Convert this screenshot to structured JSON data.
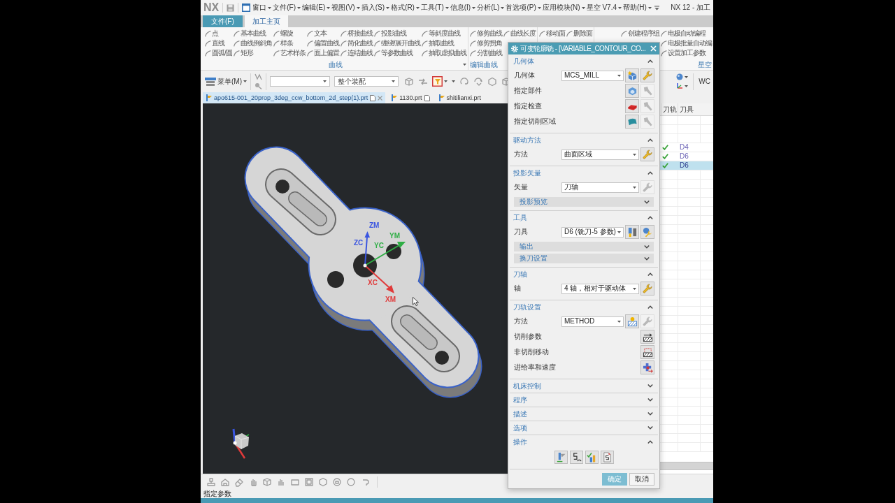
{
  "menu_bar": {
    "logo": "NX",
    "menus": [
      "窗口",
      "文件(F)",
      "编辑(E)",
      "视图(V)",
      "插入(S)",
      "格式(R)",
      "工具(T)",
      "信息(I)",
      "分析(L)",
      "首选项(P)",
      "应用模块(N)",
      "星空 V7.4",
      "帮助(H)"
    ],
    "window_title": "NX 12 - 加工"
  },
  "ribbon": {
    "tabs": [
      {
        "label": "文件(F)",
        "kind": "file",
        "selected": false
      },
      {
        "label": "加工主页",
        "kind": "tab",
        "selected": true
      }
    ],
    "groups": [
      {
        "label": "曲线",
        "more_menu": true,
        "columns": [
          [
            "点",
            "直线",
            "圆弧/圆"
          ],
          [
            "基本曲线",
            "曲线倒斜角",
            "矩形"
          ],
          [
            "螺旋",
            "样条",
            "艺术样条"
          ],
          [
            "文本",
            "偏置曲线",
            "面上偏置"
          ],
          [
            "桥接曲线",
            "简化曲线",
            "连结曲线"
          ],
          [
            "投影曲线",
            "缠绕/展开曲线",
            "等参数曲线"
          ],
          [
            "等斜度曲线",
            "抽取曲线",
            "抽取虚拟曲线"
          ]
        ]
      },
      {
        "label": "编辑曲线",
        "more_menu": false,
        "columns": [
          [
            "修剪曲线",
            "修剪拐角",
            "分割曲线"
          ],
          [
            "曲线长度"
          ]
        ]
      },
      {
        "more_menu": false,
        "columns": [
          [
            "移动面"
          ],
          [
            "删除面"
          ]
        ]
      },
      {
        "label": "星空",
        "more_menu": false,
        "columns": [
          [
            "创建程序组"
          ],
          [
            "电极自动编程",
            "电极批量自动编",
            "设置加工参数"
          ]
        ]
      }
    ]
  },
  "toolbar": {
    "menu": "菜单(M)",
    "scope": "整个装配",
    "trailing_text": "WC"
  },
  "file_tabs": [
    {
      "label": "apo615-001_20prop_3deg_ccw_bottom_2d_step(1).prt",
      "selected": true,
      "doc_icon": true
    },
    {
      "label": "1130.prt",
      "selected": false,
      "doc_icon": true
    },
    {
      "label": "shitilianxi.prt",
      "selected": false,
      "doc_icon": false
    }
  ],
  "viewport": {
    "csys_labels": [
      {
        "label": "ZM",
        "color": "#3a55e0"
      },
      {
        "label": "ZC",
        "color": "#3a55e0"
      },
      {
        "label": "YC",
        "color": "#2fae45"
      },
      {
        "label": "YM",
        "color": "#2fae45"
      },
      {
        "label": "XC",
        "color": "#e03a3a"
      },
      {
        "label": "XM",
        "color": "#e03a3a"
      }
    ]
  },
  "navigator": {
    "columns": [
      "刀轨",
      "刀具"
    ],
    "rows": [
      {
        "path_generated": true,
        "tool": "D4",
        "selected": false
      },
      {
        "path_generated": true,
        "tool": "D6",
        "selected": false
      },
      {
        "path_generated": true,
        "tool": "D6",
        "selected": true
      }
    ]
  },
  "dialog": {
    "title": "可变轮廓铣 - [VARIABLE_CONTOUR_CO...",
    "sections": [
      {
        "title": "几何体",
        "expanded": true,
        "rows": [
          {
            "kind": "select",
            "label": "几何体",
            "value": "MCS_MILL",
            "buttons": [
              {
                "kind": "new_geometry",
                "disabled": false
              },
              {
                "kind": "edit",
                "disabled": false
              }
            ]
          },
          {
            "kind": "action",
            "label": "指定部件",
            "buttons": [
              {
                "kind": "select_part",
                "disabled": false
              },
              {
                "kind": "display",
                "disabled": true
              }
            ]
          },
          {
            "kind": "action",
            "label": "指定检查",
            "buttons": [
              {
                "kind": "select_check",
                "disabled": false
              },
              {
                "kind": "display",
                "disabled": true
              }
            ]
          },
          {
            "kind": "action",
            "label": "指定切削区域",
            "buttons": [
              {
                "kind": "select_area",
                "disabled": false
              },
              {
                "kind": "display",
                "disabled": true
              }
            ]
          }
        ]
      },
      {
        "title": "驱动方法",
        "expanded": true,
        "rows": [
          {
            "kind": "select",
            "label": "方法",
            "value": "曲面区域",
            "buttons": [
              {
                "kind": "edit",
                "disabled": false
              }
            ]
          }
        ]
      },
      {
        "title": "投影矢量",
        "expanded": true,
        "rows": [
          {
            "kind": "select",
            "label": "矢量",
            "value": "刀轴",
            "buttons": [
              {
                "kind": "edit",
                "disabled": true
              }
            ]
          },
          {
            "kind": "subsection",
            "label": "投影预览",
            "expanded": false
          }
        ]
      },
      {
        "title": "工具",
        "expanded": true,
        "rows": [
          {
            "kind": "select",
            "label": "刀具",
            "value": "D6 (铣刀-5 参数)",
            "buttons": [
              {
                "kind": "new_tool",
                "disabled": false
              },
              {
                "kind": "edit_tool",
                "disabled": false
              }
            ]
          },
          {
            "kind": "subsection",
            "label": "输出",
            "expanded": false
          },
          {
            "kind": "subsection",
            "label": "换刀设置",
            "expanded": false
          }
        ]
      },
      {
        "title": "刀轴",
        "expanded": true,
        "rows": [
          {
            "kind": "select",
            "label": "轴",
            "value": "4 轴，相对于驱动体",
            "buttons": [
              {
                "kind": "edit",
                "disabled": false
              }
            ]
          }
        ]
      },
      {
        "title": "刀轨设置",
        "expanded": true,
        "rows": [
          {
            "kind": "select",
            "label": "方法",
            "value": "METHOD",
            "buttons": [
              {
                "kind": "new_method",
                "disabled": false
              },
              {
                "kind": "edit",
                "disabled": true
              }
            ]
          },
          {
            "kind": "action",
            "label": "切削参数",
            "buttons": [
              {
                "kind": "cut_params",
                "disabled": false
              }
            ]
          },
          {
            "kind": "action",
            "label": "非切削移动",
            "buttons": [
              {
                "kind": "non_cutting",
                "disabled": false
              }
            ]
          },
          {
            "kind": "action",
            "label": "进给率和速度",
            "buttons": [
              {
                "kind": "feeds",
                "disabled": false
              }
            ]
          }
        ]
      },
      {
        "title": "机床控制",
        "expanded": false
      },
      {
        "title": "程序",
        "expanded": false
      },
      {
        "title": "描述",
        "expanded": false
      },
      {
        "title": "选项",
        "expanded": false
      },
      {
        "title": "操作",
        "expanded": true,
        "rows": [
          {
            "kind": "toolbar",
            "buttons": [
              {
                "kind": "generate",
                "disabled": false
              },
              {
                "kind": "replay",
                "disabled": false
              },
              {
                "kind": "verify",
                "disabled": false
              },
              {
                "kind": "list",
                "disabled": false
              }
            ]
          }
        ]
      }
    ],
    "buttons": [
      {
        "label": "确定",
        "kind": "primary"
      },
      {
        "label": "取消",
        "kind": "secondary"
      }
    ]
  },
  "status_bar": {
    "text": "指定参数"
  }
}
